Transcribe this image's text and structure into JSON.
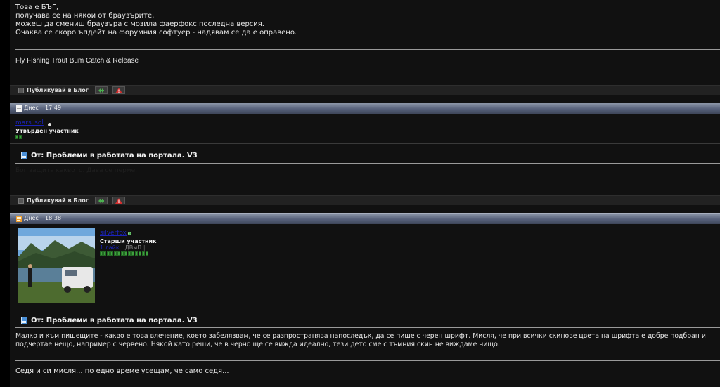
{
  "post1": {
    "body_lines": [
      "Това е БЪГ,",
      "получава се на някои от браузърите,",
      "можеш да смениш браузъра с мозила фаерфокс последна версия.",
      "Очаква се скоро ъпдейт на форумния софтуер - надявам се да е оправено."
    ],
    "signature": "Fly Fishing Trout Bum Catch & Release"
  },
  "toolbar": {
    "blog_label": "Публикувай в Блог"
  },
  "post2": {
    "date_label": "Днес",
    "time": "17:49",
    "username": "mars_sol",
    "rank": "Утвърден участник",
    "title": "От: Проблеми в работата на портала. V3",
    "body": "Бог защита каквото. Дава се перме."
  },
  "post3": {
    "date_label": "Днес",
    "time": "18:38",
    "username": "silverfox",
    "rank": "Старши участник",
    "extra_link": "1 лайк",
    "extra_tag": "ДВмП",
    "title": "От: Проблеми в работата на портала. V3",
    "body_lines": [
      "Малко и към пишещите - какво е това влечение, което забелязвам, че се разпространява напоследък, да се пише с черен шрифт. Мисля, че при всички скинове цвета на шрифта е добре подбран и",
      "подчертае нещо, например с червено. Някой като реши, че в черно ще се вижда идеално, тези дето сме с тъмния скин не виждаме нищо."
    ],
    "signature": "Седя и си мисля... по едно време усещам, че само седя..."
  },
  "colors": {
    "header_gradient": "#56607a",
    "username_link": "#1a22b8",
    "online_green": "#4caf50",
    "reputation_green": "#3ea03e"
  }
}
